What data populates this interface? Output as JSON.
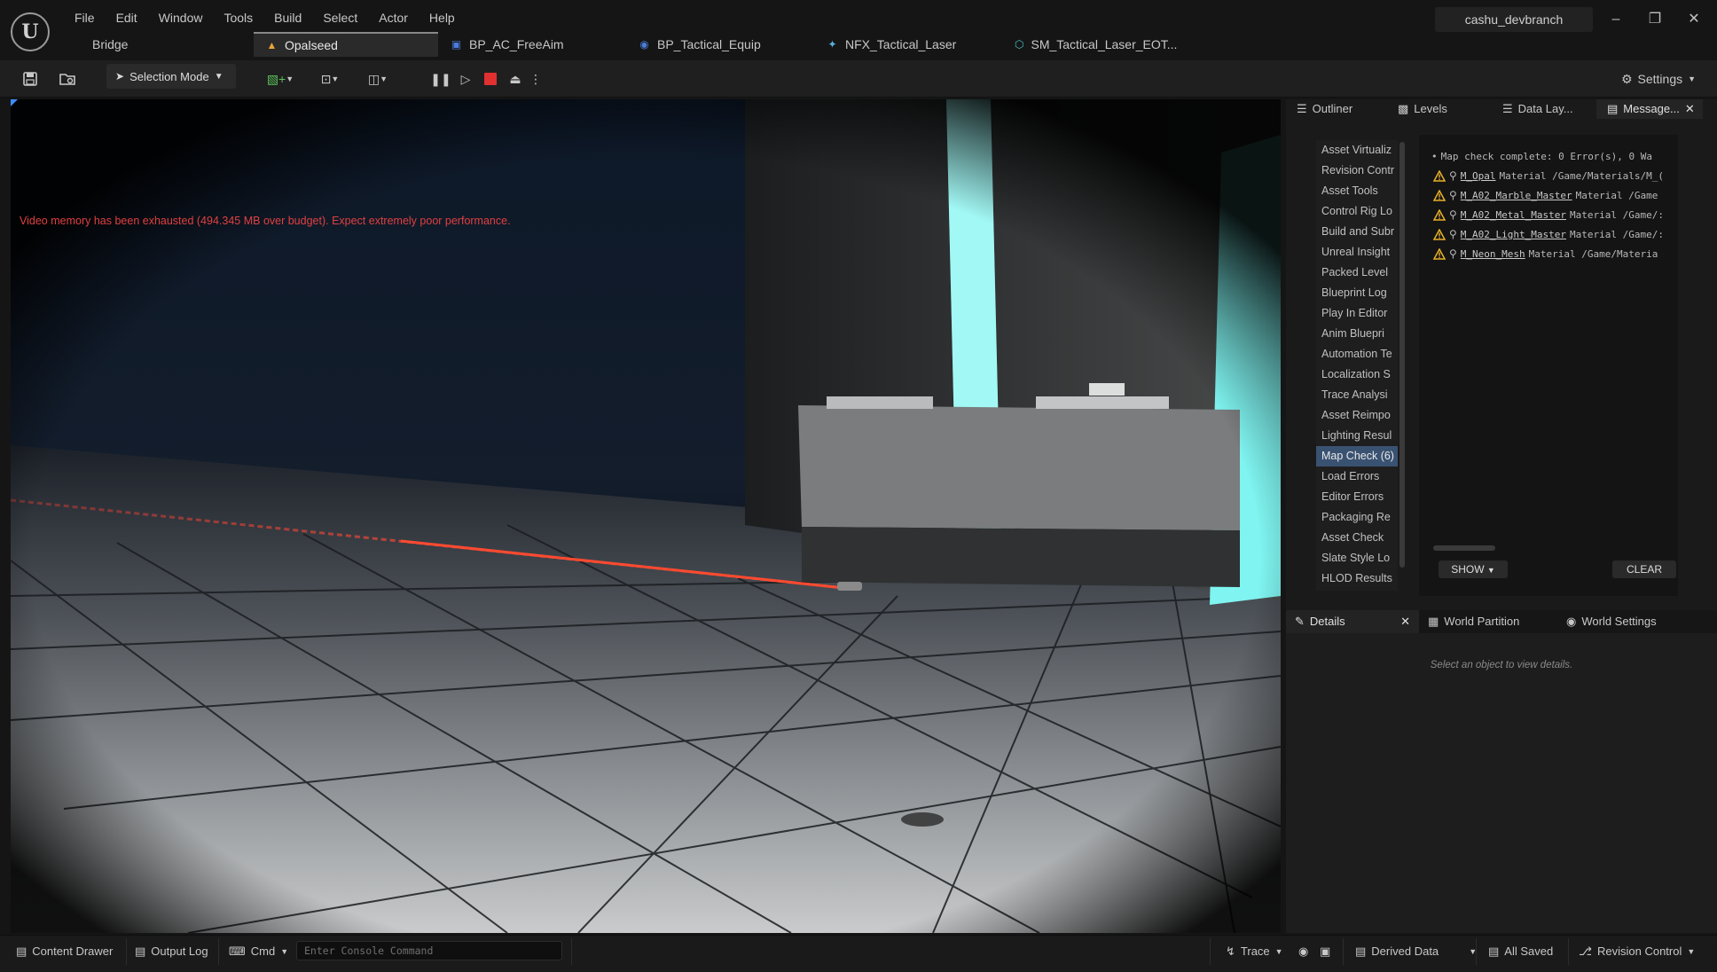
{
  "menu": [
    "File",
    "Edit",
    "Window",
    "Tools",
    "Build",
    "Select",
    "Actor",
    "Help"
  ],
  "branch": "cashu_devbranch",
  "tabs": [
    {
      "label": "Bridge",
      "icon": "none"
    },
    {
      "label": "Opalseed",
      "icon": "level-warning-icon",
      "active": true
    },
    {
      "label": "BP_AC_FreeAim",
      "icon": "blueprint-icon"
    },
    {
      "label": "BP_Tactical_Equip",
      "icon": "blueprint-icon"
    },
    {
      "label": "NFX_Tactical_Laser",
      "icon": "niagara-icon"
    },
    {
      "label": "SM_Tactical_Laser_EOT...",
      "icon": "static-mesh-icon"
    }
  ],
  "toolbar": {
    "selection_mode": "Selection Mode",
    "settings": "Settings"
  },
  "viewport": {
    "warning": "Video memory has been exhausted (494.345 MB over budget). Expect extremely poor performance."
  },
  "panel_tabs": [
    "Outliner",
    "Levels",
    "Data Lay...",
    "Message..."
  ],
  "categories": [
    "Asset Virtualiz",
    "Revision Contr",
    "Asset Tools",
    "Control Rig Lo",
    "Build and Subr",
    "Unreal Insight",
    "Packed Level",
    "Blueprint Log",
    "Play In Editor",
    "Anim Bluepri",
    "Automation Te",
    "Localization S",
    "Trace Analysi",
    "Asset Reimpo",
    "Lighting Resul",
    "Map Check (6)",
    "Load Errors",
    "Editor Errors",
    "Packaging Re",
    "Asset Check",
    "Slate Style Lo",
    "HLOD Results"
  ],
  "selected_category": "Map Check (6)",
  "messages": {
    "summary": "Map check complete: 0 Error(s), 0 Wa",
    "warnings": [
      {
        "name": "M_Opal",
        "rest": "Material /Game/Materials/M_("
      },
      {
        "name": "M_A02_Marble_Master",
        "rest": "Material /Game"
      },
      {
        "name": "M_A02_Metal_Master",
        "rest": "Material /Game/:"
      },
      {
        "name": "M_A02_Light_Master",
        "rest": "Material /Game/:"
      },
      {
        "name": "M_Neon_Mesh",
        "rest": "Material /Game/Materia"
      }
    ],
    "show_label": "SHOW",
    "clear_label": "CLEAR"
  },
  "details": {
    "tabs": [
      "Details",
      "World Partition",
      "World Settings"
    ],
    "hint": "Select an object to view details."
  },
  "statusbar": {
    "content_drawer": "Content Drawer",
    "output_log": "Output Log",
    "cmd": "Cmd",
    "console_placeholder": "Enter Console Command",
    "trace": "Trace",
    "derived_data": "Derived Data",
    "all_saved": "All Saved",
    "revision_control": "Revision Control"
  },
  "colors": {
    "laser": "#ff3b2f",
    "neon": "#7ff4f0",
    "warning_text": "#e04040",
    "selection": "#3a5272"
  }
}
